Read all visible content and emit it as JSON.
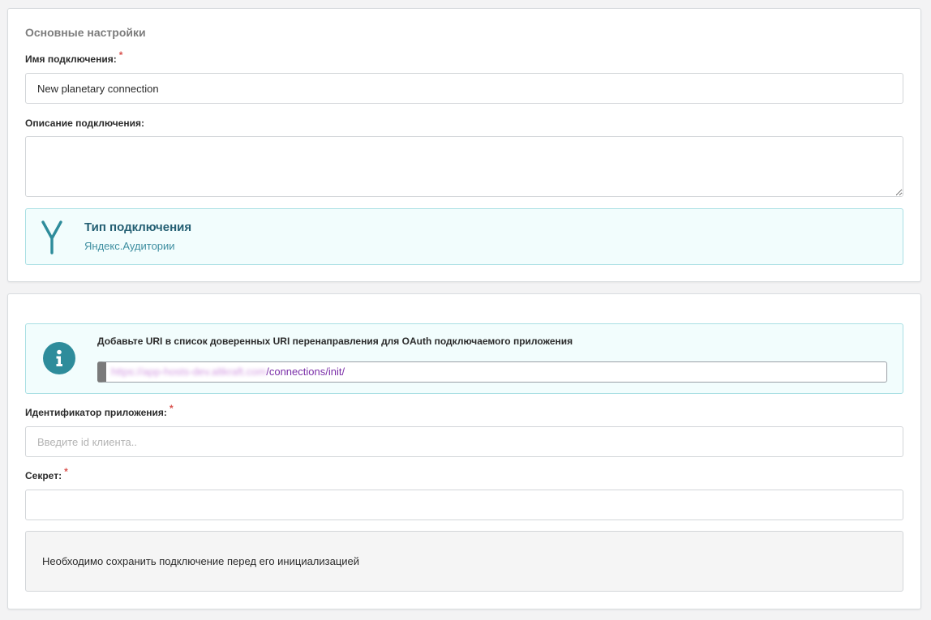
{
  "main_settings": {
    "title": "Основные настройки",
    "name_label": "Имя подключения:",
    "name_required": "*",
    "name_value": "New planetary connection",
    "description_label": "Описание подключения:",
    "description_value": ""
  },
  "connection_type": {
    "title": "Тип подключения",
    "value": "Яндекс.Аудитории",
    "icon": "yandex-y-icon",
    "accent_color": "#2e8c9b"
  },
  "oauth": {
    "info_text": "Добавьте URI в список доверенных URI перенаправления для OAuth подключаемого приложения",
    "info_icon": "info-icon",
    "uri_host_blurred": "https://app-hosts-dev.altkraft.com",
    "uri_path": "/connections/init/",
    "app_id_label": "Идентификатор приложения:",
    "app_id_required": "*",
    "app_id_placeholder": "Введите id клиента..",
    "secret_label": "Секрет:",
    "secret_required": "*",
    "secret_value": ""
  },
  "notice": {
    "text": "Необходимо сохранить подключение перед его инициализацией"
  }
}
